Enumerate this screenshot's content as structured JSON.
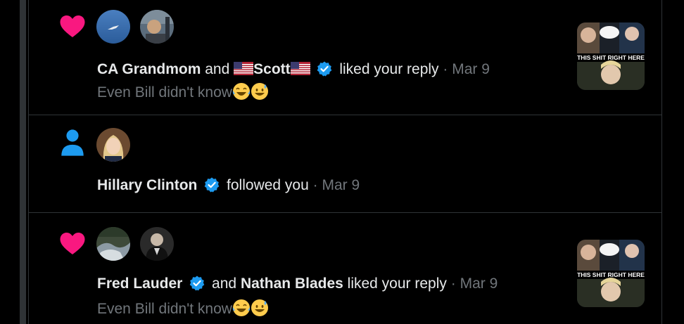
{
  "colors": {
    "heart": "#f91880",
    "person": "#1d9bf0",
    "verified": "#1d9bf0",
    "divider": "#2f3336",
    "dim_text": "#71767b"
  },
  "notifications": [
    {
      "type": "like",
      "icon": "heart-icon",
      "actor1": "CA Grandmom",
      "conj": "and",
      "actor2": "Scott",
      "action": "liked your reply",
      "sep": "·",
      "date": "Mar 9",
      "preview": "Even Bill didn't know",
      "thumb_text": "THIS SHIT RIGHT HERE"
    },
    {
      "type": "follow",
      "icon": "person-icon",
      "actor1": "Hillary Clinton",
      "action": "followed you",
      "sep": "·",
      "date": "Mar 9"
    },
    {
      "type": "like",
      "icon": "heart-icon",
      "actor1": "Fred Lauder",
      "conj": "and",
      "actor2": "Nathan Blades",
      "action": "liked your reply",
      "sep": "·",
      "date": "Mar 9",
      "preview": "Even Bill didn't know",
      "thumb_text": "THIS SHIT RIGHT HERE"
    }
  ]
}
